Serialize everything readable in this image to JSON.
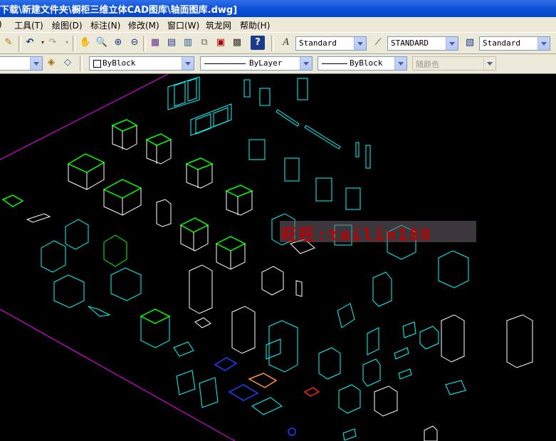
{
  "window": {
    "title": "下载\\新建文件夹\\橱柜三维立体CAD图库\\轴面图库.dwg]"
  },
  "menu": [
    {
      "label": "工具(T)"
    },
    {
      "label": "绘图(D)"
    },
    {
      "label": "标注(N)"
    },
    {
      "label": "修改(M)"
    },
    {
      "label": "窗口(W)"
    },
    {
      "label": "筑龙网"
    },
    {
      "label": "帮助(H)"
    }
  ],
  "toolbar": {
    "text_style": "Standard",
    "dim_style": "STANDARD",
    "table_style": "Standard"
  },
  "properties": {
    "color": "ByBlock",
    "linetype": "ByLayer",
    "lineweight": "ByBlock",
    "plot_style": "随颜色"
  },
  "watermark": "旺旺:tailin188",
  "colors": {
    "title_bar": "#0a4fd6",
    "toolbar_bg": "#ece9d8",
    "drawing_bg": "#000000",
    "cyan": "#00ffff",
    "white": "#ffffff",
    "green": "#00ff00",
    "magenta": "#ff00ff",
    "blue": "#2040ff",
    "watermark_text": "#c00000"
  },
  "icons": [
    "pencil-icon",
    "undo-icon",
    "redo-icon",
    "pan-icon",
    "zoom-realtime-icon",
    "zoom-window-icon",
    "zoom-previous-icon",
    "properties-icon",
    "design-center-icon",
    "tool-palette-icon",
    "sheet-set-icon",
    "markup-icon",
    "calculator-icon",
    "help-icon",
    "text-style-icon",
    "dim-style-icon",
    "table-style-icon",
    "layer-states-icon",
    "layer-previous-icon"
  ]
}
